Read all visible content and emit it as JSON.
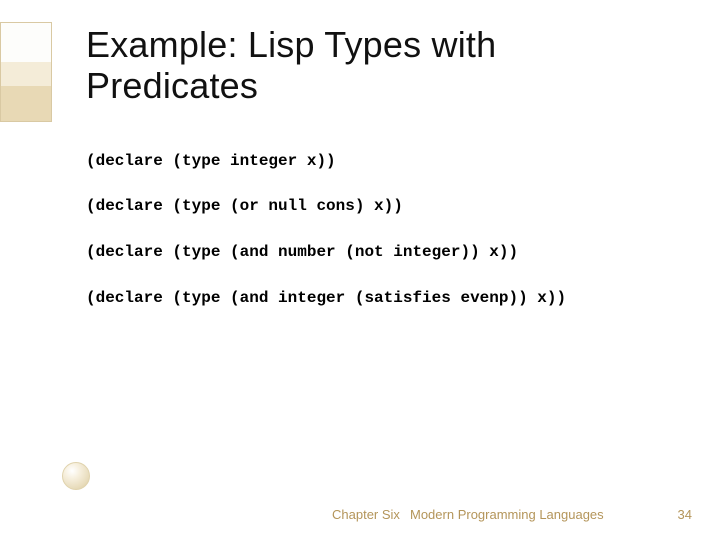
{
  "title": "Example: Lisp Types with Predicates",
  "code": {
    "line1": "(declare (type integer x))",
    "line2": "(declare (type (or null cons) x))",
    "line3": "(declare (type (and number (not integer)) x))",
    "line4": "(declare (type (and integer (satisfies evenp)) x))"
  },
  "footer": {
    "chapter": "Chapter Six",
    "book": "Modern Programming Languages",
    "page": "34"
  }
}
